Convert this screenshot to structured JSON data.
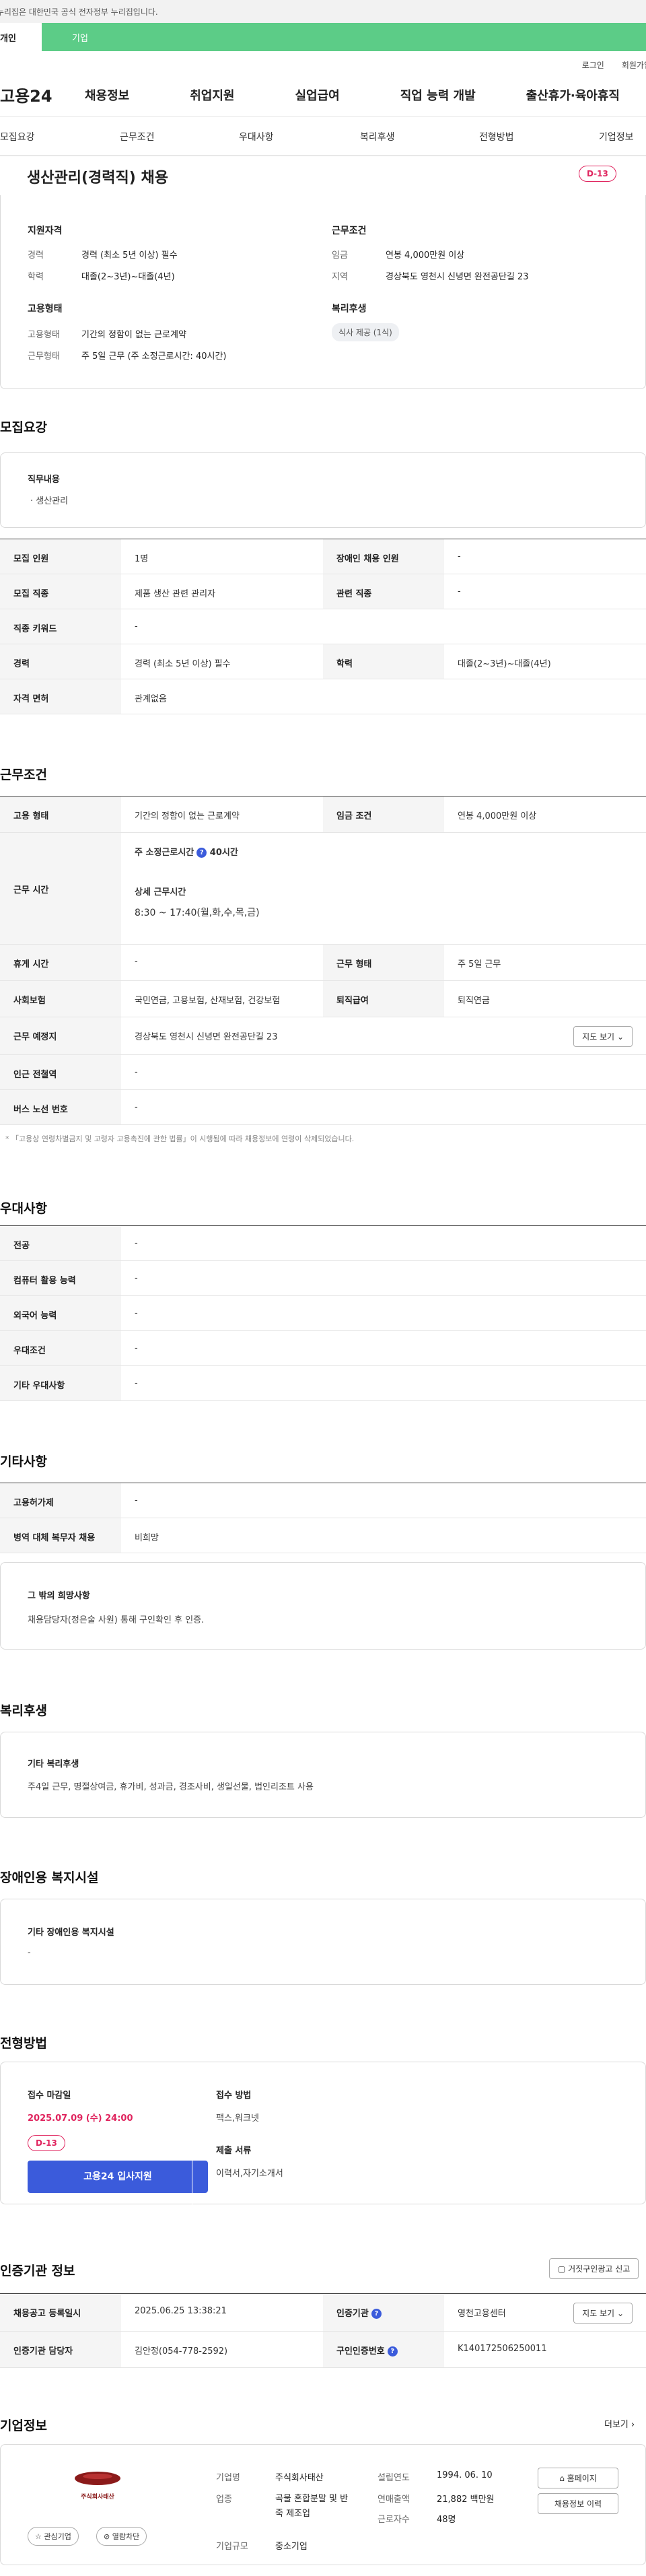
{
  "gov_bar": "이 누리집은 대한민국 공식 전자정부 누리집입니다.",
  "top_tabs": {
    "personal": "개인",
    "business": "기업"
  },
  "util": {
    "login": "로그인",
    "join": "회원가입"
  },
  "gnb": {
    "logo": "고용24",
    "items": [
      "채용정보",
      "취업지원",
      "실업급여",
      "직업 능력 개발",
      "출산휴가·육아휴직"
    ]
  },
  "lnb": [
    "모집요강",
    "근무조건",
    "우대사항",
    "복리후생",
    "전형방법",
    "기업정보"
  ],
  "job": {
    "title": "생산관리(경력직) 채용",
    "dday": "D-13",
    "qual_title": "지원자격",
    "career_label": "경력",
    "career_value": "경력 (최소 5년 이상) 필수",
    "edu_label": "학력",
    "edu_value": "대졸(2~3년)~대졸(4년)",
    "work_title": "근무조건",
    "wage_label": "임금",
    "wage_value": "연봉 4,000만원 이상",
    "region_label": "지역",
    "region_value": "경상북도 영천시 신녕면 완전공단길 23",
    "emp_title": "고용형태",
    "emptype_label": "고용형태",
    "emptype_value": "기간의 정함이 없는 근로계약",
    "worktype_label": "근무형태",
    "worktype_value": "주 5일 근무 (주 소정근로시간: 40시간)",
    "welfare_title": "복리후생",
    "welfare_tag": "식사 제공 (1식)"
  },
  "recruit": {
    "section": "모집요강",
    "duty_title": "직무내용",
    "duty_item": "· 생산관리",
    "rows": [
      [
        "모집 인원",
        "1명",
        "장애인 채용 인원",
        "-"
      ],
      [
        "모집 직종",
        "제품 생산 관련 관리자",
        "관련 직종",
        "-"
      ],
      [
        "직종 키워드",
        "-",
        "",
        ""
      ],
      [
        "경력",
        "경력 (최소 5년 이상) 필수",
        "학력",
        "대졸(2~3년)~대졸(4년)"
      ],
      [
        "자격 면허",
        "관계없음",
        "",
        ""
      ]
    ]
  },
  "conditions": {
    "section": "근무조건",
    "emp_label": "고용 형태",
    "emp_value": "기간의 정함이 없는 근로계약",
    "wage_label": "임금 조건",
    "wage_value": "연봉 4,000만원 이상",
    "hours_label": "근무 시간",
    "hours_week": "주 소정근로시간",
    "hours_week_value": "40시간",
    "hours_detail_title": "상세 근무시간",
    "hours_detail": "8:30 ~ 17:40(월,화,수,목,금)",
    "rest_label": "휴게 시간",
    "rest_value": "-",
    "shift_label": "근무 형태",
    "shift_value": "주 5일 근무",
    "insurance_label": "사회보험",
    "insurance_value": "국민연금, 고용보험, 산재보험, 건강보험",
    "retire_label": "퇴직급여",
    "retire_value": "퇴직연금",
    "place_label": "근무 예정지",
    "place_value": "경상북도 영천시 신녕면 완전공단길 23",
    "map_btn": "지도 보기",
    "station_label": "인근 전철역",
    "station_value": "-",
    "bus_label": "버스 노선 번호",
    "bus_value": "-",
    "note": "「고용상 연령차별금지 및 고령자 고용촉진에 관한 법률」이 시행됨에 따라 채용정보에 연령이 삭제되었습니다."
  },
  "prefer": {
    "section": "우대사항",
    "rows": [
      [
        "전공",
        "-"
      ],
      [
        "컴퓨터 활용 능력",
        "-"
      ],
      [
        "외국어 능력",
        "-"
      ],
      [
        "우대조건",
        "-"
      ],
      [
        "기타 우대사항",
        "-"
      ]
    ]
  },
  "etc": {
    "section": "기타사항",
    "rows": [
      [
        "고용허가제",
        "-"
      ],
      [
        "병역 대체 복무자 채용",
        "비희망"
      ]
    ],
    "wish_title": "그 밖의 희망사항",
    "wish_text": "채용담당자(정은술 사원) 통해 구인확인 후 인증."
  },
  "welfare": {
    "section": "복리후생",
    "title": "기타 복리후생",
    "text": "주4일 근무, 명절상여금, 휴가비, 성과금, 경조사비, 생일선물, 법인리조트 사용"
  },
  "disabled": {
    "section": "장애인용 복지시설",
    "title": "기타 장애인용 복지시설",
    "text": "-"
  },
  "process": {
    "section": "전형방법",
    "deadline_title": "접수 마감일",
    "deadline": "2025.07.09 (수) 24:00",
    "dday": "D-13",
    "apply_btn": "고용24 입사지원",
    "method_title": "접수 방법",
    "method": "팩스,워크넷",
    "docs_title": "제출 서류",
    "docs": "이력서,자기소개서"
  },
  "cert": {
    "section": "인증기관 정보",
    "report_btn": "거짓구인광고 신고",
    "reg_label": "채용공고 등록일시",
    "reg_value": "2025.06.25 13:38:21",
    "org_label": "인증기관",
    "org_value": "영천고용센터",
    "map_btn": "지도 보기",
    "manager_label": "인증기관 담당자",
    "manager_value": "김안정(054-778-2592)",
    "num_label": "구인인증번호",
    "num_value": "K140172506250011"
  },
  "company": {
    "section": "기업정보",
    "more": "더보기",
    "logo_text": "주식회사태산",
    "fav_btn": "관심기업",
    "block_btn": "열람차단",
    "name_label": "기업명",
    "name_value": "주식회사태산",
    "year_label": "설립연도",
    "year_value": "1994. 06. 10",
    "ind_label": "업종",
    "ind_value": "곡물 혼합분말 및 반죽 제조업",
    "sales_label": "연매출액",
    "sales_value": "21,882 백만원",
    "emp_label": "근로자수",
    "emp_value": "48명",
    "size_label": "기업규모",
    "size_value": "중소기업",
    "home_btn": "홈페이지",
    "history_btn": "채용정보 이력"
  },
  "colors": {
    "accent_green": "#5ccc87",
    "dday_pink": "#e0245e",
    "primary_blue": "#3b5bdb"
  }
}
